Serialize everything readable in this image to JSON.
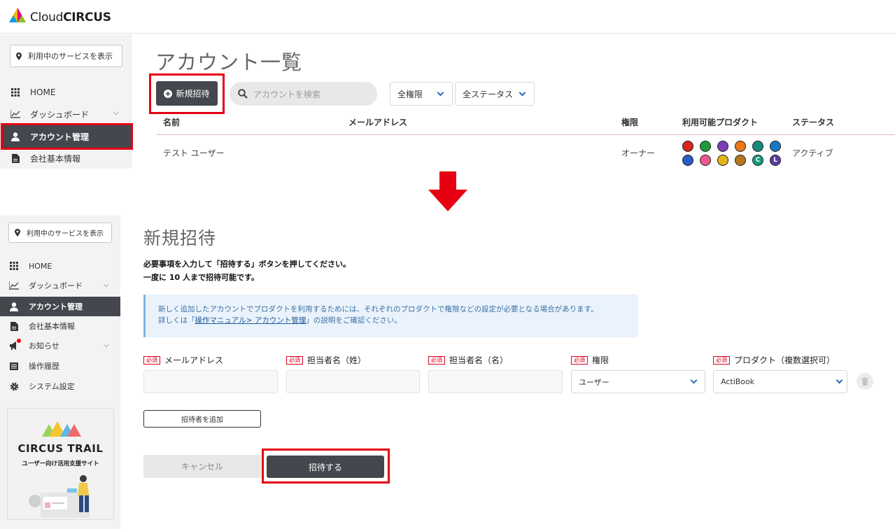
{
  "brand": {
    "name_light": "Cloud",
    "name_bold": "CIRCUS"
  },
  "sidebar": {
    "service_button": "利用中のサービスを表示",
    "items_top": [
      {
        "label": "HOME",
        "icon": "grid-icon"
      },
      {
        "label": "ダッシュボード",
        "icon": "chart-line-icon"
      },
      {
        "label": "アカウント管理",
        "icon": "user-icon",
        "active": true
      },
      {
        "label": "会社基本情報",
        "icon": "document-icon"
      }
    ],
    "items_bottom": [
      {
        "label": "HOME",
        "icon": "grid-icon"
      },
      {
        "label": "ダッシュボード",
        "icon": "chart-line-icon"
      },
      {
        "label": "アカウント管理",
        "icon": "user-icon",
        "active": true
      },
      {
        "label": "会社基本情報",
        "icon": "document-icon"
      },
      {
        "label": "お知らせ",
        "icon": "megaphone-icon"
      },
      {
        "label": "操作履歴",
        "icon": "list-icon"
      },
      {
        "label": "システム設定",
        "icon": "gear-icon"
      }
    ],
    "banner": {
      "title": "CIRCUS TRAIL",
      "subtitle": "ユーザー向け活用支援サイト"
    }
  },
  "account_list": {
    "title": "アカウント一覧",
    "new_invite_button": "新規招待",
    "search_placeholder": "アカウントを検索",
    "filter_role": "全権限",
    "filter_status": "全ステータス",
    "columns": [
      "名前",
      "メールアドレス",
      "権限",
      "利用可能プロダクト",
      "ステータス"
    ],
    "rows": [
      {
        "name": "テスト ユーザー",
        "email": "",
        "role": "オーナー",
        "status": "アクティブ"
      }
    ],
    "product_icon_colors": [
      "#d7261e",
      "#1f9b3a",
      "#7b3fb8",
      "#e8771a",
      "#168a7b",
      "#1a78c2",
      "#2a5cc7",
      "#e85a8a",
      "#e0b51a",
      "#b5781e",
      "#129a7a",
      "#5a3c9e"
    ],
    "product_icon_letters": [
      "",
      "",
      "",
      "",
      "",
      "",
      "",
      "",
      "",
      "",
      "C",
      "L"
    ]
  },
  "new_invite": {
    "title": "新規招待",
    "instruction_1": "必要事項を入力して「招待する」ボタンを押してください。",
    "instruction_2": "一度に 10 人まで招待可能です。",
    "info_line_1": "新しく追加したアカウントでプロダクトを利用するためには、それぞれのプロダクトで権限などの設定が必要となる場合があります。",
    "info_line_2_prefix": "詳しくは「",
    "info_link": "操作マニュアル> アカウント管理",
    "info_line_2_suffix": "」の説明をご確認ください。",
    "required_badge": "必須",
    "fields": {
      "email": "メールアドレス",
      "last_name": "担当者名（姓）",
      "first_name": "担当者名（名）",
      "role": "権限",
      "product": "プロダクト（複数選択可）"
    },
    "role_value": "ユーザー",
    "product_value": "ActiBook",
    "add_invitee_button": "招待者を追加",
    "cancel_button": "キャンセル",
    "submit_button": "招待する"
  },
  "colors": {
    "accent_red": "#e60012",
    "dark": "#45474f",
    "info_bg": "#eaf3fb"
  }
}
